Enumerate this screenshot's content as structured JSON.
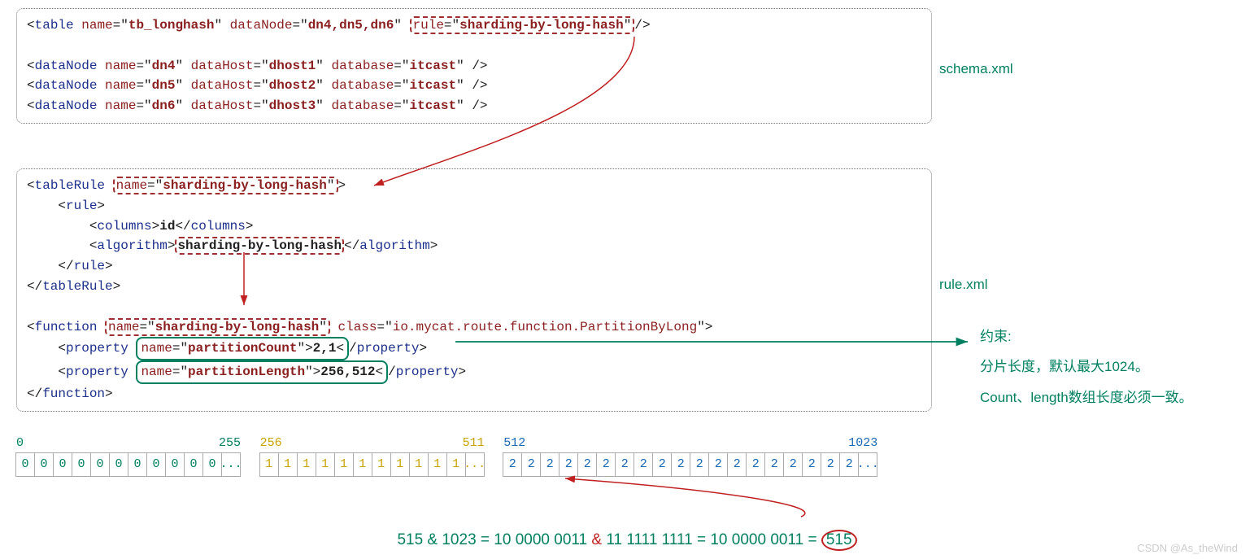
{
  "schema": {
    "tableTag": "table",
    "tableName": "tb_longhash",
    "dataNode": "dn4,dn5,dn6",
    "ruleAttr": "rule",
    "ruleValue": "sharding-by-long-hash",
    "nodes": [
      {
        "tag": "dataNode",
        "name": "dn4",
        "host": "dhost1",
        "db": "itcast"
      },
      {
        "tag": "dataNode",
        "name": "dn5",
        "host": "dhost2",
        "db": "itcast"
      },
      {
        "tag": "dataNode",
        "name": "dn6",
        "host": "dhost3",
        "db": "itcast"
      }
    ],
    "label": "schema.xml"
  },
  "rule": {
    "tableRuleTag": "tableRule",
    "nameAttr": "name",
    "ruleName": "sharding-by-long-hash",
    "ruleTag": "rule",
    "columnsTag": "columns",
    "columnsVal": "id",
    "algorithmTag": "algorithm",
    "algorithmVal": "sharding-by-long-hash",
    "functionTag": "function",
    "functionName": "sharding-by-long-hash",
    "classAttr": "class",
    "classVal": "io.mycat.route.function.PartitionByLong",
    "propertyTag": "property",
    "propCount": "partitionCount",
    "propCountVal": "2,1",
    "propLength": "partitionLength",
    "propLengthVal": "256,512",
    "label": "rule.xml"
  },
  "constraint": {
    "l1": "约束:",
    "l2": "分片长度，默认最大1024。",
    "l3": "Count、length数组长度必须一致。"
  },
  "strip": {
    "start0": "0",
    "end0": "255",
    "cells0": [
      "0",
      "0",
      "0",
      "0",
      "0",
      "0",
      "0",
      "0",
      "0",
      "0",
      "0",
      "..."
    ],
    "start1": "256",
    "end1": "511",
    "cells1": [
      "1",
      "1",
      "1",
      "1",
      "1",
      "1",
      "1",
      "1",
      "1",
      "1",
      "1",
      "..."
    ],
    "start2": "512",
    "end2": "1023",
    "cells2": [
      "2",
      "2",
      "2",
      "2",
      "2",
      "2",
      "2",
      "2",
      "2",
      "2",
      "2",
      "2",
      "2",
      "2",
      "2",
      "2",
      "2",
      "2",
      "2",
      "..."
    ]
  },
  "formula": {
    "a": "515 & 1023 = 10 0000 0011 ",
    "amp": "&",
    "b": " 11 1111 1111 = 10 0000 0011 =",
    "res": "515"
  },
  "watermark": "CSDN @As_theWind"
}
